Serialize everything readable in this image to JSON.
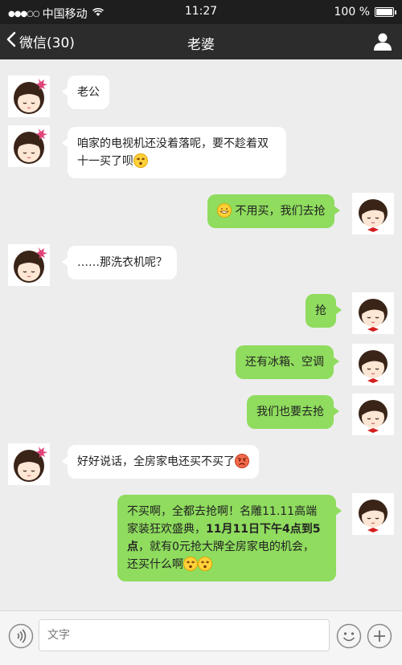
{
  "status": {
    "carrier": "中国移动",
    "time": "11:27",
    "battery": "100 %",
    "battery_level": 1.0
  },
  "nav": {
    "back_label": "微信(30)",
    "title": "老婆"
  },
  "messages": [
    {
      "from": "her",
      "text": "老公"
    },
    {
      "from": "her",
      "line1": "咱家的电视机还没着落呢，要不趁着双",
      "line2": "十一买了呗"
    },
    {
      "from": "me",
      "text": "不用买，我们去抢"
    },
    {
      "from": "her",
      "text": "……那洗衣机呢？"
    },
    {
      "from": "me",
      "text": "抢"
    },
    {
      "from": "me",
      "text": "还有冰箱、空调"
    },
    {
      "from": "me",
      "text": "我们也要去抢"
    },
    {
      "from": "her",
      "text": "好好说话，全房家电还买不买了"
    },
    {
      "from": "me",
      "l1": "不买啊，全都去抢啊！名雕11.11高端",
      "l2": "家装狂欢盛典，",
      "l2b": "11月11日下午4点到5",
      "l3b": "点",
      "l3": "，就有0元抢大牌全房家电的机会，",
      "l4": "还买什么啊"
    }
  ],
  "input": {
    "placeholder": "文字"
  }
}
